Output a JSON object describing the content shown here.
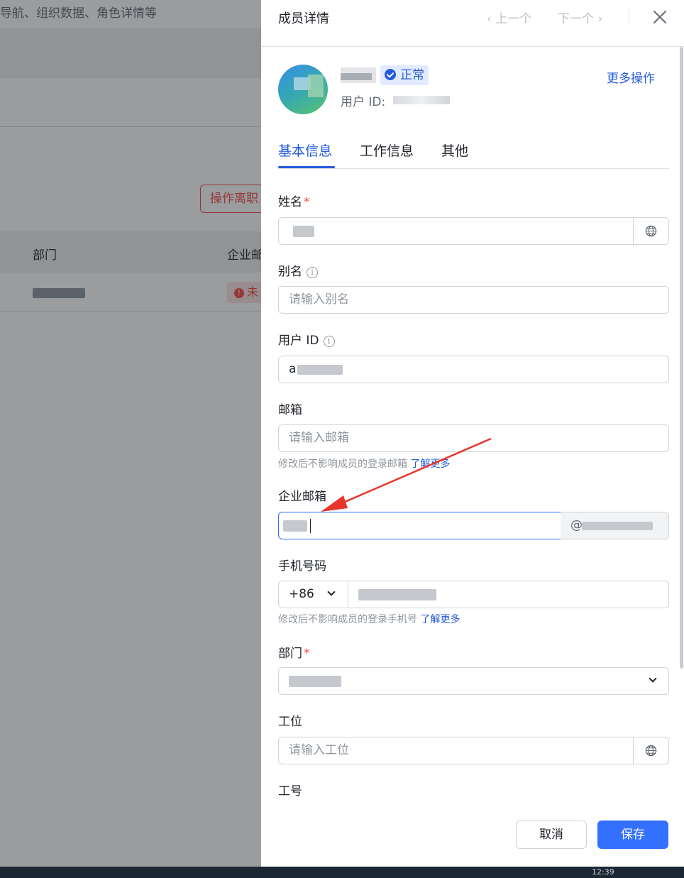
{
  "background": {
    "breadcrumb_text": "导航、组织数据、角色详情等",
    "offboard_button": "操作离职",
    "table_headers": [
      "部门",
      "企业邮箱"
    ],
    "row_status": "未"
  },
  "drawer": {
    "title": "成员详情",
    "prev_label": "上一个",
    "next_label": "下一个",
    "profile": {
      "status": "正常",
      "user_id_label": "用户 ID:",
      "more_actions": "更多操作"
    },
    "tabs": [
      "基本信息",
      "工作信息",
      "其他"
    ],
    "active_tab_index": 0,
    "fields": {
      "name": {
        "label": "姓名",
        "required_mark": "*"
      },
      "alias": {
        "label": "别名",
        "placeholder": "请输入别名"
      },
      "user_id": {
        "label": "用户 ID",
        "value": "a"
      },
      "email": {
        "label": "邮箱",
        "placeholder": "请输入邮箱",
        "hint": "修改后不影响成员的登录邮箱",
        "hint_link": "了解更多"
      },
      "enterprise_email": {
        "label": "企业邮箱",
        "suffix": "@"
      },
      "mobile": {
        "label": "手机号码",
        "country_code": "+86",
        "hint": "修改后不影响成员的登录手机号",
        "hint_link": "了解更多"
      },
      "department": {
        "label": "部门",
        "required_mark": "*"
      },
      "workstation": {
        "label": "工位",
        "placeholder": "请输入工位"
      },
      "employee_no": {
        "label": "工号"
      }
    },
    "footer": {
      "cancel": "取消",
      "save": "保存"
    }
  },
  "taskbar": {
    "clock": "12:39"
  },
  "colors": {
    "primary": "#3370ff",
    "link": "#245bdb",
    "danger": "#f54a45",
    "annotation_arrow": "#e8352a"
  },
  "icons": [
    "close-icon",
    "chevron-left-icon",
    "chevron-right-icon",
    "verified-check-icon",
    "info-icon",
    "globe-icon",
    "chevron-down-icon"
  ]
}
